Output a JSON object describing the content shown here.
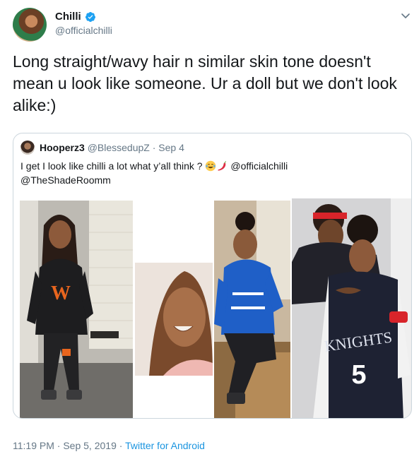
{
  "tweet": {
    "display_name": "Chilli",
    "handle": "@officialchilli",
    "verified": true,
    "text": "Long straight/wavy hair n similar skin tone doesn't mean u look like someone. Ur a doll but we don't look alike:)"
  },
  "quoted_tweet": {
    "display_name": "Hooperz3",
    "handle": "@BlessedupZ",
    "date": "Sep 4",
    "text_before_emoji": "I get I look like chilli a lot what y’all think ?",
    "mention_1": "@officialchilli",
    "mention_2": "@TheShadeRoomm",
    "emojis": [
      "face-with-tears-of-joy-icon",
      "hot-pepper-icon"
    ],
    "photos": [
      {
        "name": "photo-hoodie",
        "shirt_text": "W"
      },
      {
        "name": "photo-smiling-woman"
      },
      {
        "name": "photo-blue-jacket"
      },
      {
        "name": "photo-knights-jersey",
        "jersey_text": "KNIGHTS",
        "jersey_number": "5"
      }
    ]
  },
  "footer": {
    "time": "11:19 PM",
    "separator": "·",
    "date": "Sep 5, 2019",
    "source": "Twitter for Android"
  },
  "colors": {
    "text": "#14171a",
    "muted": "#657786",
    "link": "#1b95e0",
    "verified": "#1da1f2",
    "border": "#ccd6dd"
  }
}
